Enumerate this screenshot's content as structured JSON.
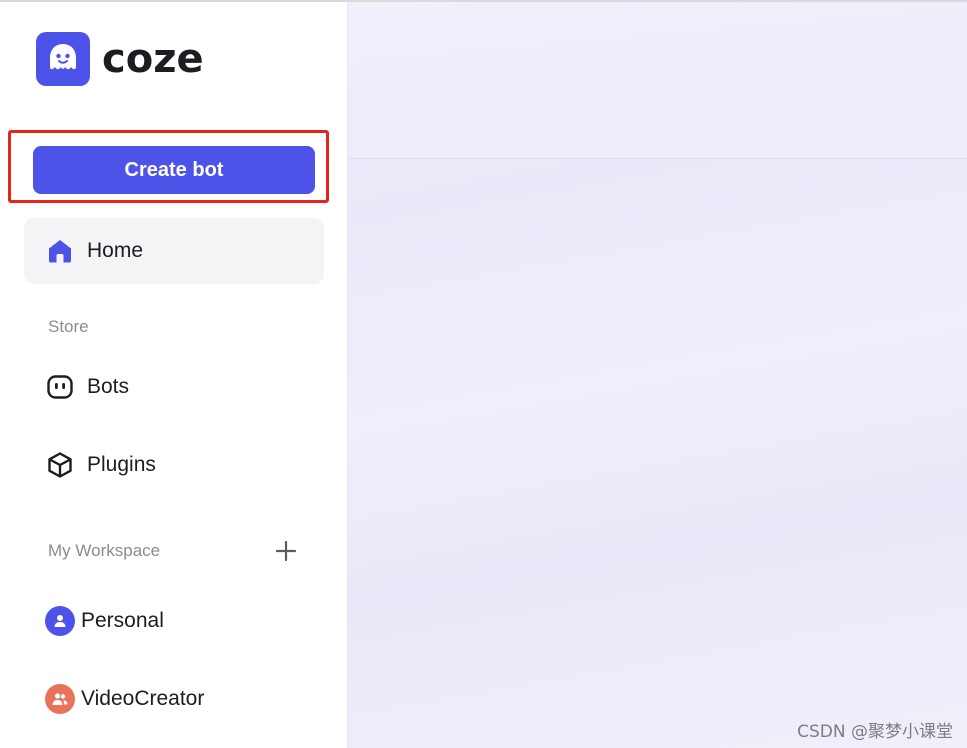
{
  "brand": {
    "name": "coze",
    "icon": "coze-ghost-logo-icon",
    "accent_color": "#4d53e8"
  },
  "actions": {
    "create_bot_label": "Create bot",
    "highlight_color": "#e8231a"
  },
  "nav": {
    "home": {
      "label": "Home",
      "icon": "home-icon"
    }
  },
  "store": {
    "section_label": "Store",
    "items": [
      {
        "label": "Bots",
        "icon": "bot-face-icon"
      },
      {
        "label": "Plugins",
        "icon": "cube-icon"
      }
    ]
  },
  "workspace": {
    "section_label": "My Workspace",
    "add_icon": "plus-icon",
    "items": [
      {
        "label": "Personal",
        "icon": "user-icon",
        "avatar_color": "#4d53e8"
      },
      {
        "label": "VideoCreator",
        "icon": "group-icon",
        "avatar_color": "#e8735a"
      }
    ]
  },
  "watermark": {
    "text": "CSDN @聚梦小课堂"
  }
}
